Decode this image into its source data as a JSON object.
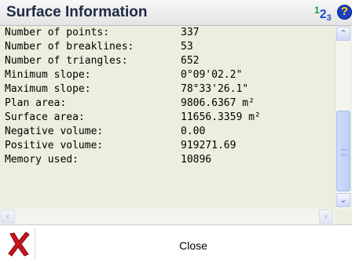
{
  "window": {
    "title": "Surface Information",
    "help_glyph": "?",
    "number_icon": {
      "d1": "1",
      "d2": "2",
      "d3": "3"
    }
  },
  "info": {
    "rows": [
      {
        "label": "Number of points:",
        "value": "337"
      },
      {
        "label": "Number of breaklines:",
        "value": "53"
      },
      {
        "label": "Number of triangles:",
        "value": "652"
      },
      {
        "label": "Minimum slope:",
        "value": "0°09'02.2\""
      },
      {
        "label": "Maximum slope:",
        "value": "78°33'26.1\""
      },
      {
        "label": "Plan area:",
        "value": "9806.6367 m²"
      },
      {
        "label": "Surface area:",
        "value": "11656.3359 m²"
      },
      {
        "label": "Negative volume:",
        "value": "0.00"
      },
      {
        "label": "Positive volume:",
        "value": "919271.69"
      },
      {
        "label": "Memory used:",
        "value": "10896"
      }
    ]
  },
  "scrollbars": {
    "up_glyph": "⌃",
    "down_glyph": "⌄",
    "left_glyph": "‹",
    "right_glyph": "›"
  },
  "footer": {
    "close_label": "Close"
  },
  "colors": {
    "panel_bg": "#ecefdd",
    "cancel_red": "#c8161d",
    "help_blue": "#1b3fc8"
  }
}
